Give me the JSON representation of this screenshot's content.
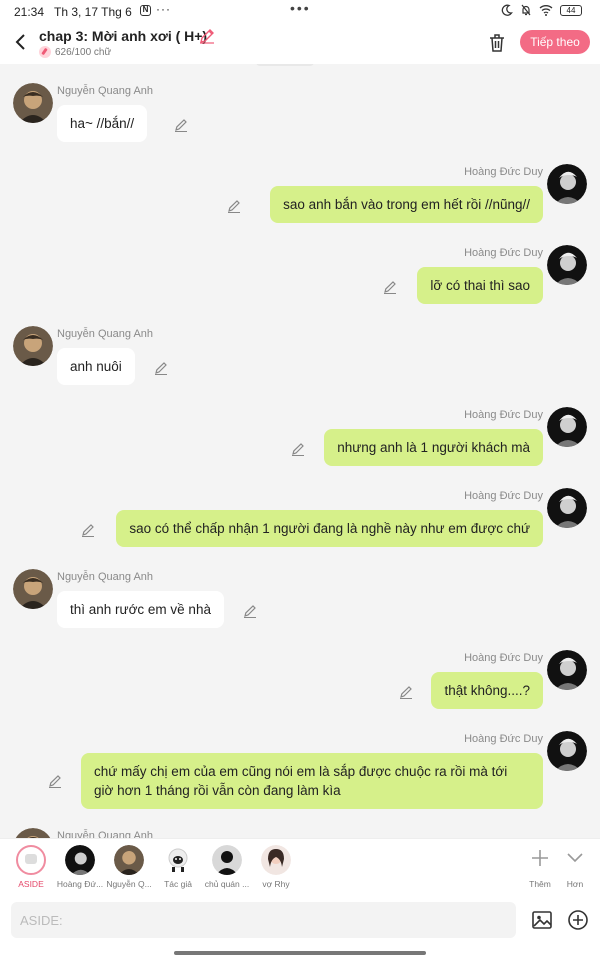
{
  "status_bar": {
    "time": "21:34",
    "date": "Th 3, 17 Thg 6",
    "app_icon": "N",
    "overflow": "···",
    "center_dots": "•••",
    "battery": "44"
  },
  "header": {
    "title": "chap 3: Mời anh xơi ( H+)",
    "word_count": "626/100 chữ",
    "next_button": "Tiếp theo",
    "accent_color": "#f36b85"
  },
  "characters": {
    "aside": {
      "name": "ASIDE",
      "icon": "chat-bubble-icon"
    },
    "duy": {
      "name": "Hoàng Đức Duy",
      "short": "Hoàng Đứ..."
    },
    "anh": {
      "name": "Nguyễn Quang Anh",
      "short": "Nguyễn Q..."
    },
    "author": {
      "short": "Tác giả"
    },
    "owner": {
      "short": "chủ quán ..."
    },
    "wife": {
      "short": "vợ Rhy"
    }
  },
  "messages": [
    {
      "side": "left",
      "sender": "Nguyễn Quang Anh",
      "text": "ha~ //bắn//"
    },
    {
      "side": "right",
      "sender": "Hoàng Đức Duy",
      "text": "sao anh bắn vào trong em hết rồi //nũng//"
    },
    {
      "side": "right",
      "sender": "Hoàng Đức Duy",
      "text": "lỡ có thai thì sao"
    },
    {
      "side": "left",
      "sender": "Nguyễn Quang Anh",
      "text": "anh nuôi"
    },
    {
      "side": "right",
      "sender": "Hoàng Đức Duy",
      "text": "nhưng anh là 1 người khách mà"
    },
    {
      "side": "right",
      "sender": "Hoàng Đức Duy",
      "text": "sao có thể chấp nhận 1 người đang là nghề này như em được chứ"
    },
    {
      "side": "left",
      "sender": "Nguyễn Quang Anh",
      "text": "thì anh rước em về nhà"
    },
    {
      "side": "right",
      "sender": "Hoàng Đức Duy",
      "text": "thật không....?"
    },
    {
      "side": "right",
      "sender": "Hoàng Đức Duy",
      "text": "chứ mấy chị em của em cũng nói em là sắp được chuộc ra rồi mà tới giờ hơn 1 tháng rồi vẫn còn đang làm kìa"
    },
    {
      "side": "left",
      "sender": "Nguyễn Quang Anh",
      "text": ""
    }
  ],
  "tools": {
    "add": "Thêm",
    "more": "Hơn"
  },
  "input": {
    "placeholder": "ASIDE:"
  },
  "colors": {
    "right_bubble": "#d6f08a",
    "left_bubble": "#ffffff",
    "background": "#f4f4f4"
  }
}
